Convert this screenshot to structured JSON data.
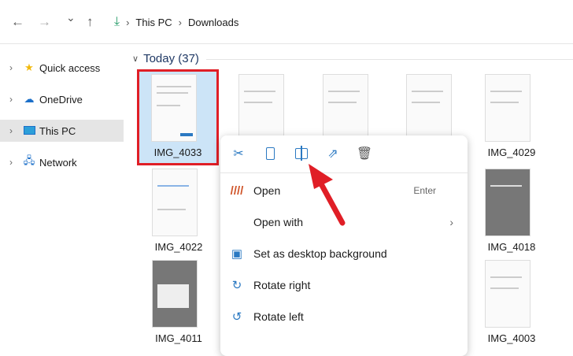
{
  "nav": {
    "back": "←",
    "forward": "→",
    "recent": "⌄",
    "up": "↑"
  },
  "breadcrumb": [
    "This PC",
    "Downloads"
  ],
  "sidebar": {
    "items": [
      {
        "label": "Quick access",
        "icon": "star-icon"
      },
      {
        "label": "OneDrive",
        "icon": "cloud-icon"
      },
      {
        "label": "This PC",
        "icon": "computer-icon"
      },
      {
        "label": "Network",
        "icon": "network-icon"
      }
    ]
  },
  "group": {
    "title": "Today (37)"
  },
  "files": [
    "IMG_4033",
    "",
    "",
    "",
    "IMG_4029",
    "IMG_4022",
    "IMG_4018",
    "IMG_4011",
    "IMG_4003"
  ],
  "menu": {
    "tools": [
      "cut",
      "copy",
      "rename",
      "share",
      "delete"
    ],
    "items": [
      {
        "label": "Open",
        "shortcut": "Enter"
      },
      {
        "label": "Open with"
      },
      {
        "label": "Set as desktop background"
      },
      {
        "label": "Rotate right"
      },
      {
        "label": "Rotate left"
      }
    ]
  },
  "colors": {
    "highlight": "#e01e26",
    "accent": "#2b79c2",
    "selection": "#cce4f7"
  }
}
